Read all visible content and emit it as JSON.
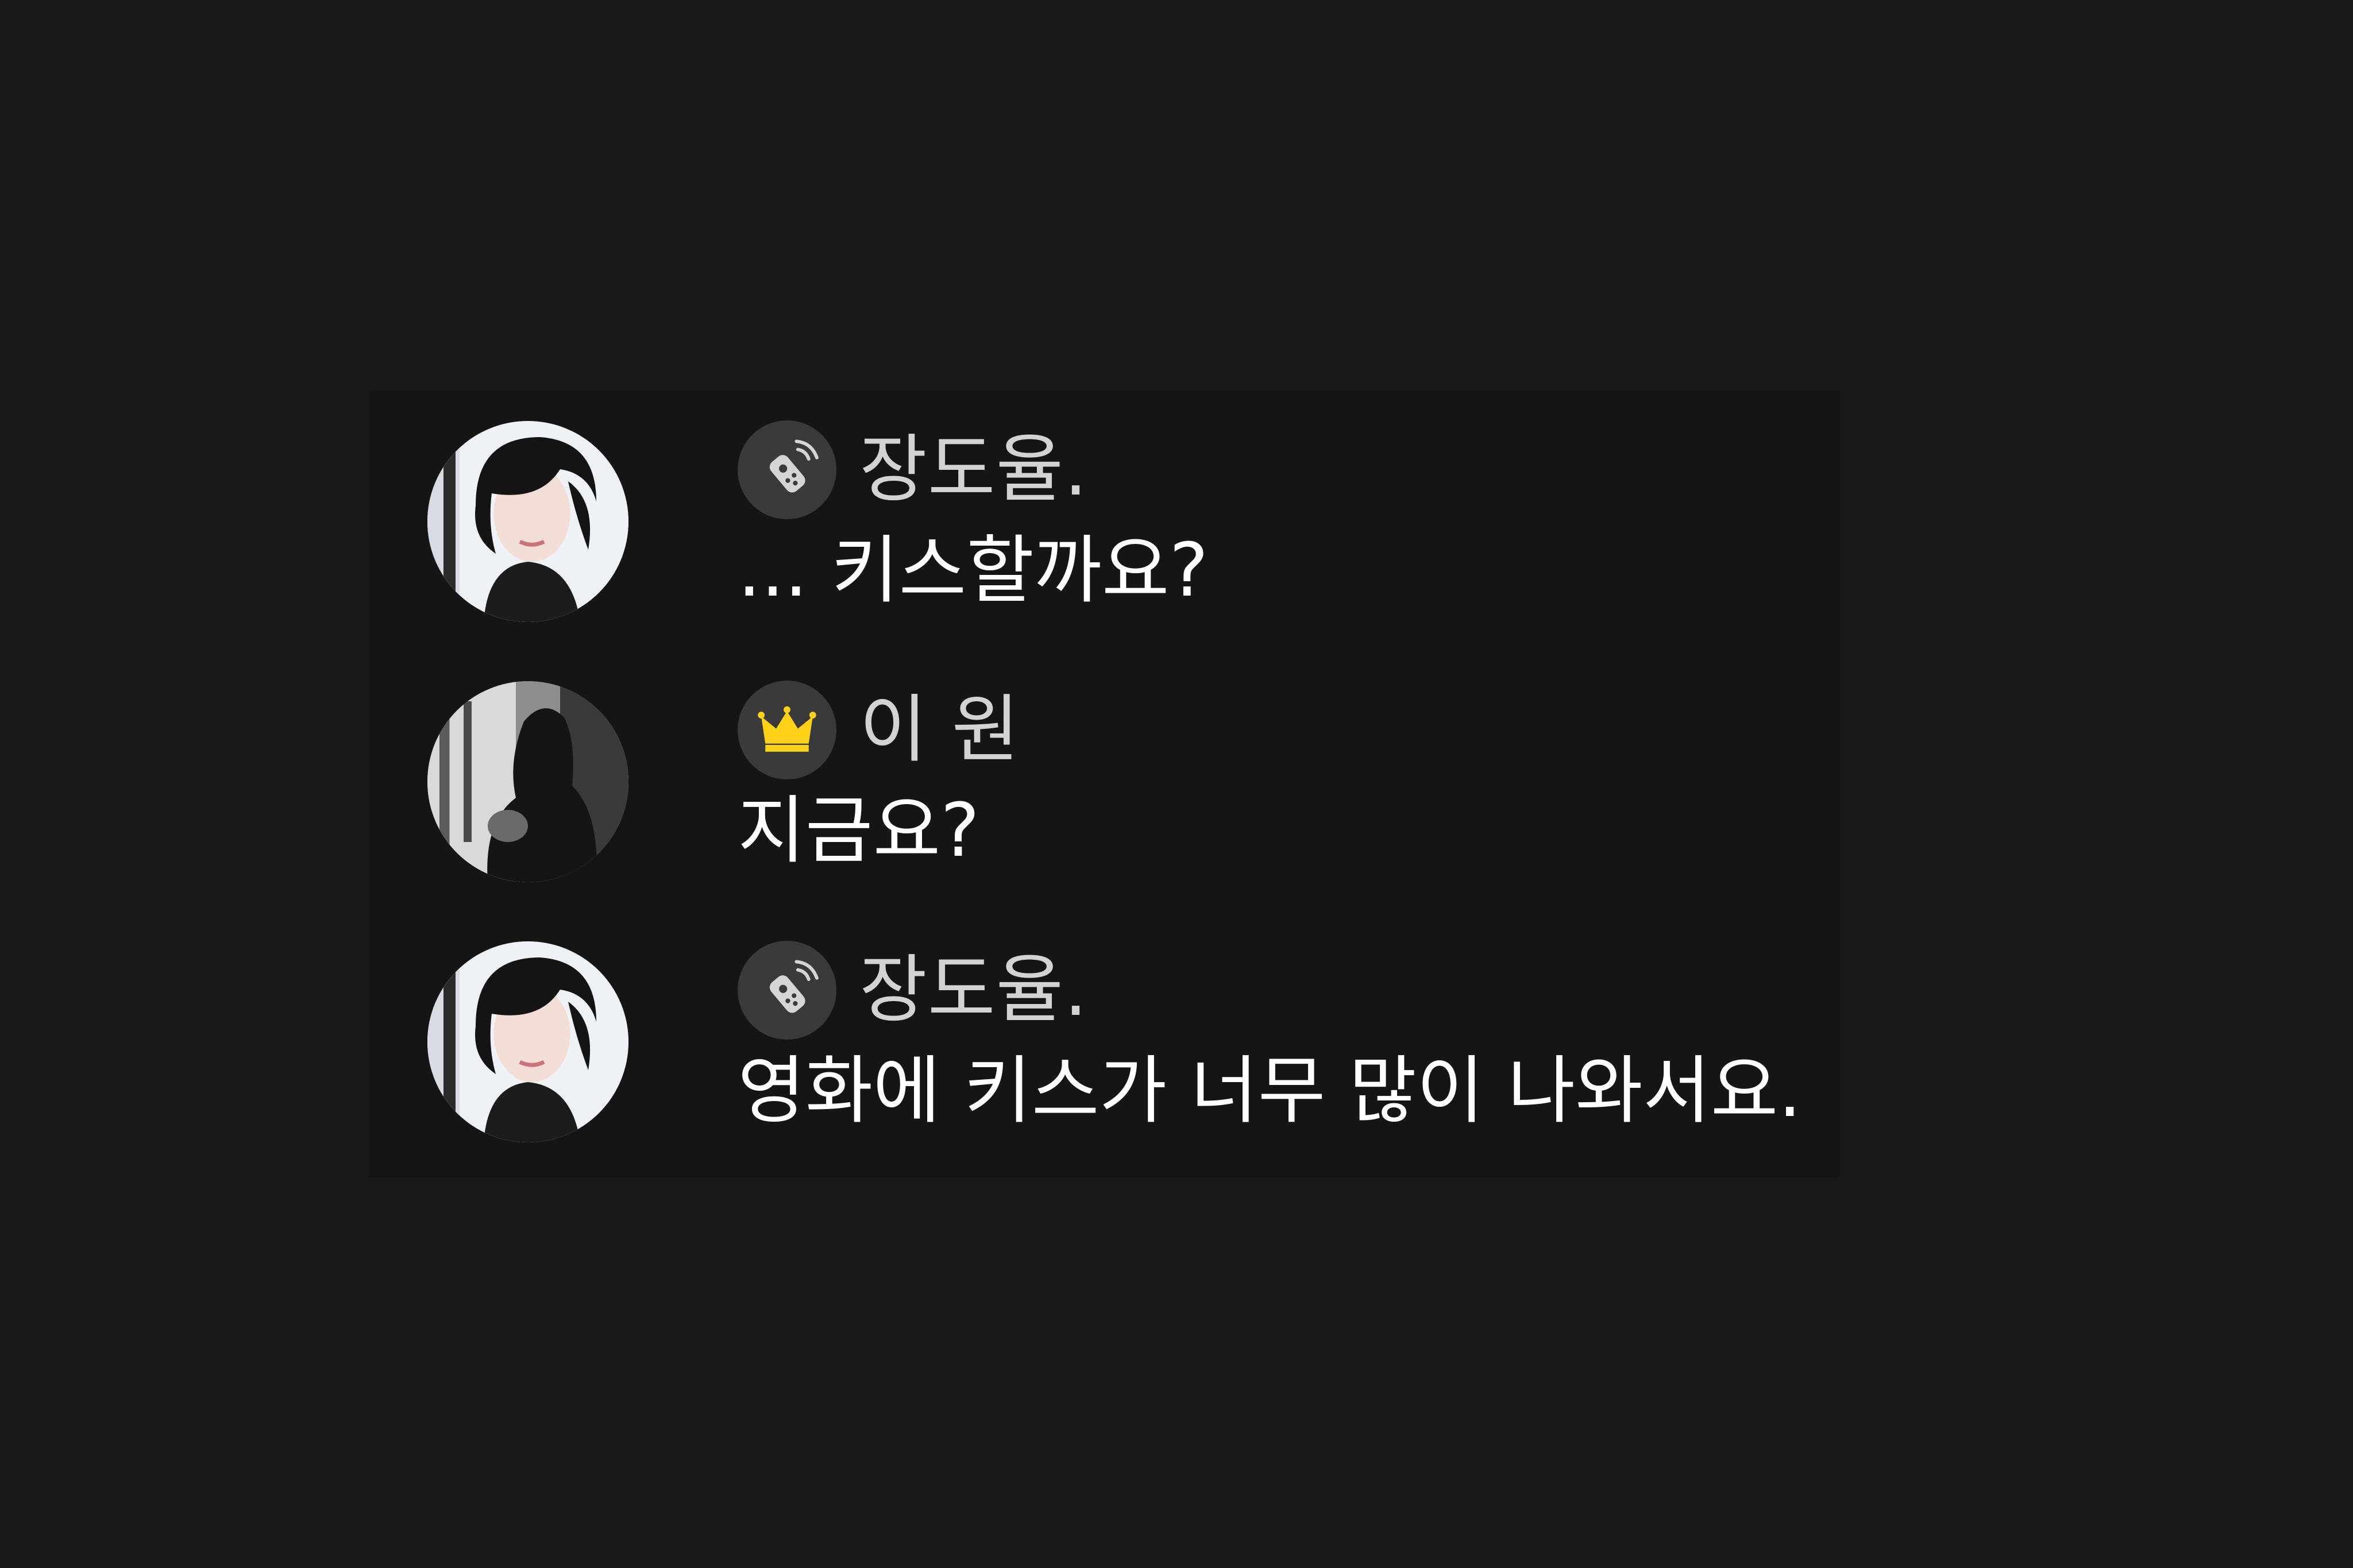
{
  "colors": {
    "background": "#181818",
    "panel": "#151515",
    "name_text": "#d3d3d3",
    "message_text": "#ffffff",
    "badge_bg": "#3a3a3a",
    "crown": "#ffd21a"
  },
  "messages": [
    {
      "sender": "장도율.",
      "badge_icon": "remote-control-icon",
      "avatar": "male-portrait",
      "text": "... 키스할까요?"
    },
    {
      "sender": "이 원",
      "badge_icon": "crown-icon",
      "avatar": "female-silhouette-portrait",
      "text": "지금요?"
    },
    {
      "sender": "장도율.",
      "badge_icon": "remote-control-icon",
      "avatar": "male-portrait",
      "text": "영화에 키스가 너무 많이 나와서요."
    }
  ]
}
